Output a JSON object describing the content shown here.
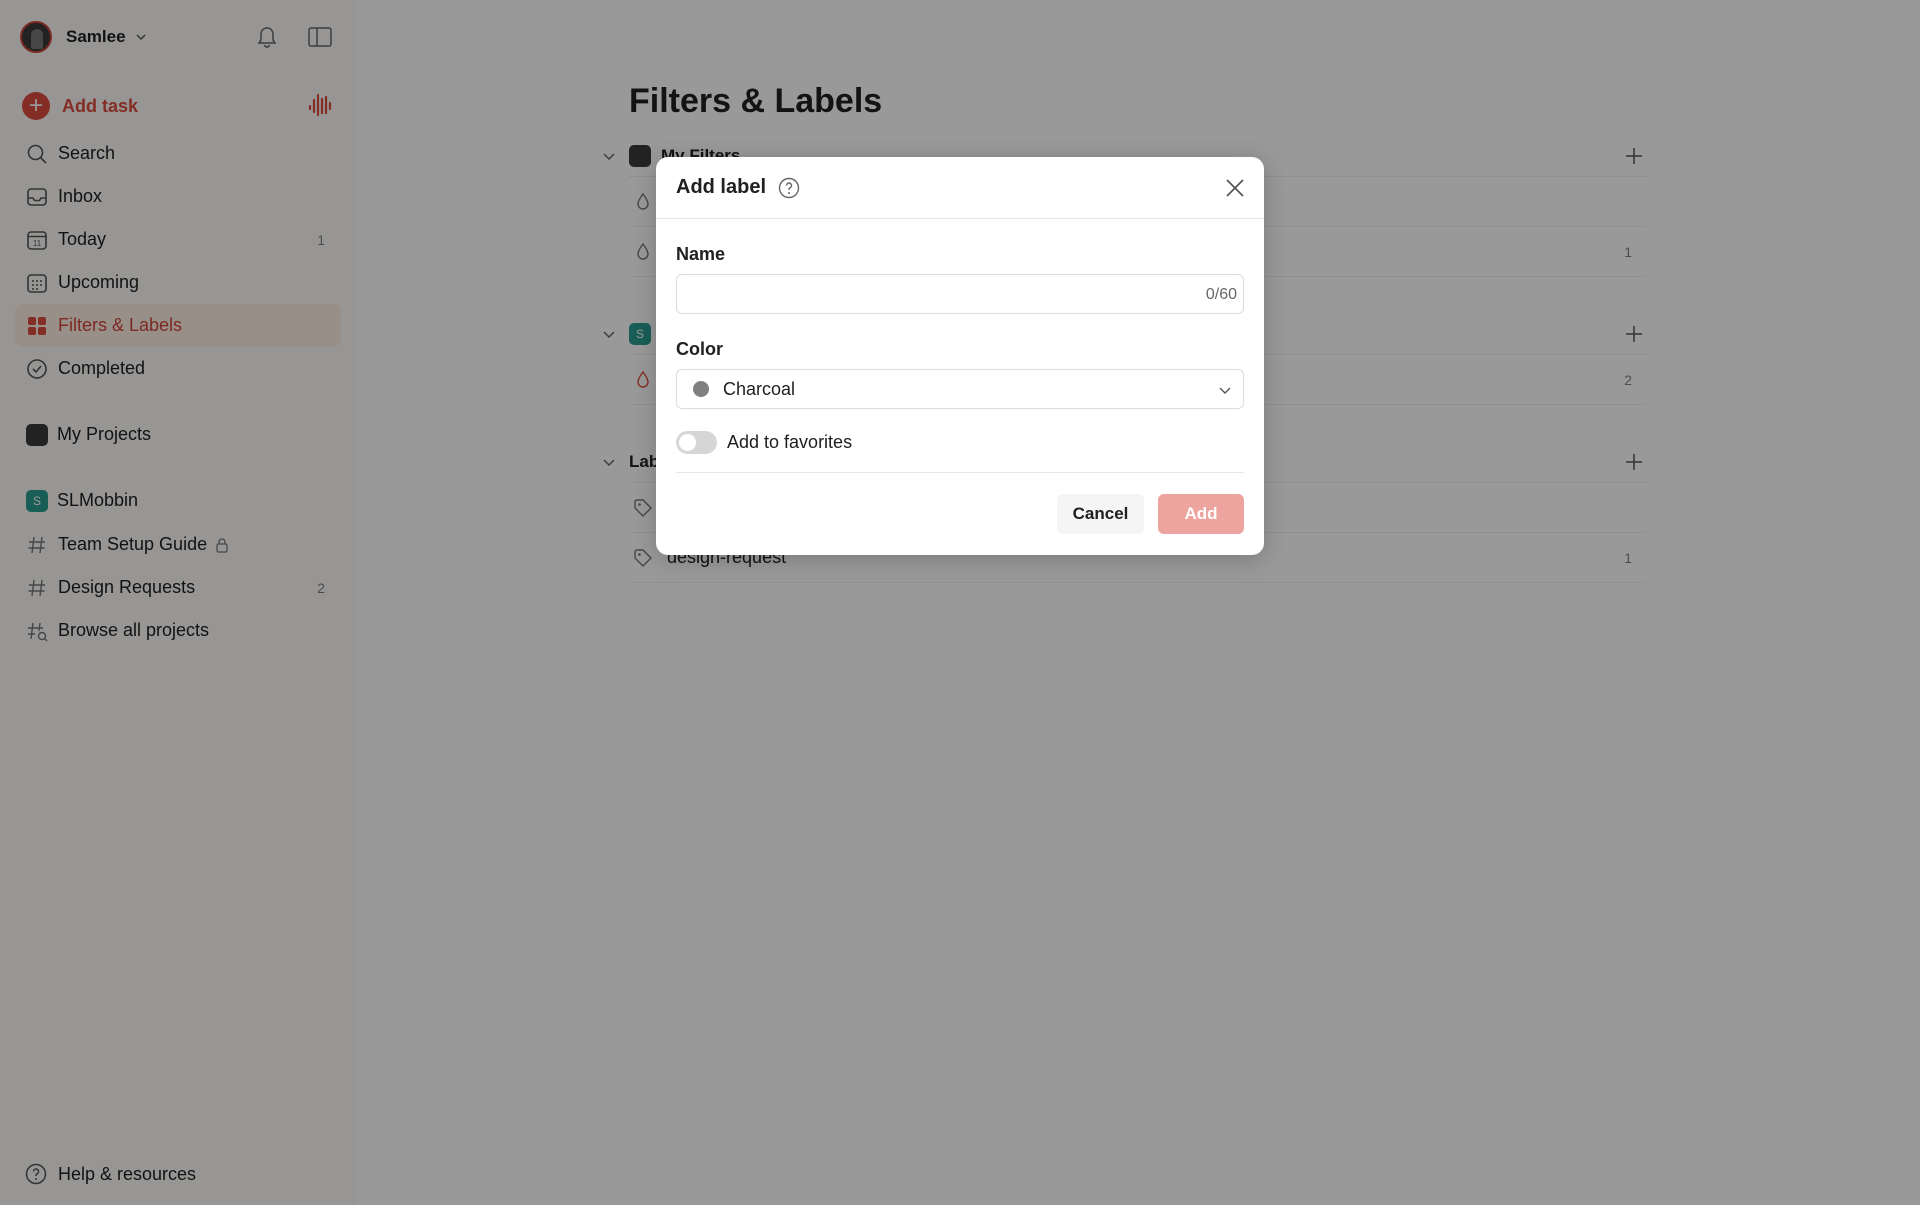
{
  "sidebar": {
    "user_name": "Samlee",
    "add_task": "Add task",
    "nav": [
      {
        "label": "Search",
        "count": ""
      },
      {
        "label": "Inbox",
        "count": ""
      },
      {
        "label": "Today",
        "count": "1"
      },
      {
        "label": "Upcoming",
        "count": ""
      },
      {
        "label": "Filters & Labels",
        "count": ""
      },
      {
        "label": "Completed",
        "count": ""
      }
    ],
    "my_projects": "My Projects",
    "team": {
      "name": "SLMobbin",
      "initial": "S"
    },
    "projects": [
      {
        "label": "Team Setup Guide",
        "count": ""
      },
      {
        "label": "Design Requests",
        "count": "2"
      },
      {
        "label": "Browse all projects",
        "count": ""
      }
    ],
    "help": "Help & resources"
  },
  "main": {
    "title": "Filters & Labels",
    "sections": {
      "my_filters": "My Filters",
      "team_initial": "S",
      "labels": "Labels"
    },
    "rows": [
      {
        "label": "",
        "count": ""
      },
      {
        "label": "",
        "count": "1"
      },
      {
        "label": "",
        "count": "2"
      },
      {
        "label": "",
        "count": ""
      },
      {
        "label": "design-request",
        "count": "1"
      }
    ]
  },
  "modal": {
    "title": "Add label",
    "name_label": "Name",
    "name_value": "",
    "char_count": "0/60",
    "color_label": "Color",
    "color_value": "Charcoal",
    "color_hex": "#808080",
    "favorites_label": "Add to favorites",
    "favorites_on": false,
    "cancel": "Cancel",
    "add": "Add"
  },
  "colors": {
    "accent": "#dc4c3e",
    "team_avatar": "#2a9d8f"
  }
}
